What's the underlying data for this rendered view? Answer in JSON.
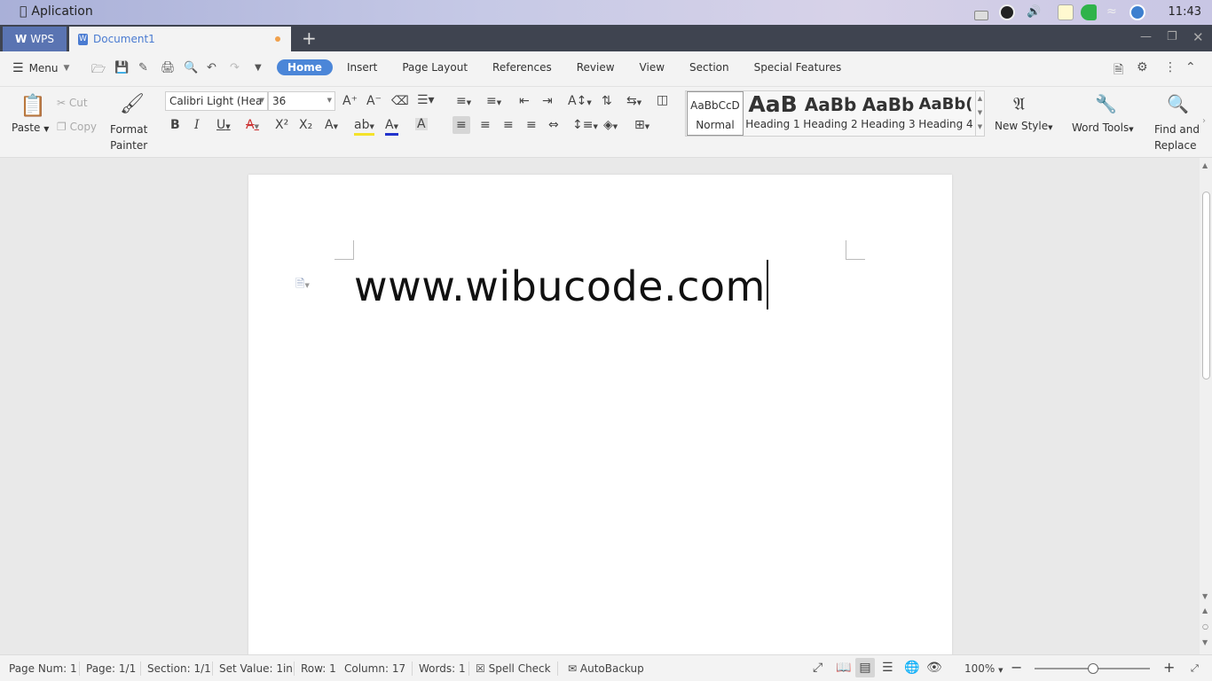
{
  "system_bar": {
    "app_name": "Aplication",
    "clock": "11:43"
  },
  "tab_bar": {
    "wps_label": "WPS",
    "document_tab": "Document1",
    "new_tab": "+"
  },
  "menu_row": {
    "menu_label": "Menu",
    "tabs": [
      "Home",
      "Insert",
      "Page Layout",
      "References",
      "Review",
      "View",
      "Section",
      "Special Features"
    ],
    "active_tab": "Home"
  },
  "ribbon": {
    "paste": "Paste",
    "cut": "Cut",
    "copy": "Copy",
    "format_painter": [
      "Format",
      "Painter"
    ],
    "font_name": "Calibri Light (Hea",
    "font_size": "36",
    "styles": [
      {
        "preview": "AaBbCcD",
        "label": "Normal"
      },
      {
        "preview": "AaB",
        "label": "Heading 1"
      },
      {
        "preview": "AaBb",
        "label": "Heading 2"
      },
      {
        "preview": "AaBb",
        "label": "Heading 3"
      },
      {
        "preview": "AaBb(",
        "label": "Heading 4"
      }
    ],
    "new_style": "New Style",
    "word_tools": "Word Tools",
    "find_replace": [
      "Find and",
      "Replace"
    ]
  },
  "document": {
    "text": "www.wibucode.com"
  },
  "status_bar": {
    "page_num": "Page Num: 1",
    "page": "Page: 1/1",
    "section": "Section: 1/1",
    "set_value": "Set Value: 1in",
    "row": "Row: 1",
    "column": "Column: 17",
    "words": "Words: 1",
    "spell_check": "Spell Check",
    "autobackup": "AutoBackup",
    "zoom": "100%"
  },
  "colors": {
    "accent": "#4b86d8",
    "tab_bar": "#3f4450",
    "wps_button": "#5a74b2",
    "modified_dot": "#f0a04b"
  }
}
